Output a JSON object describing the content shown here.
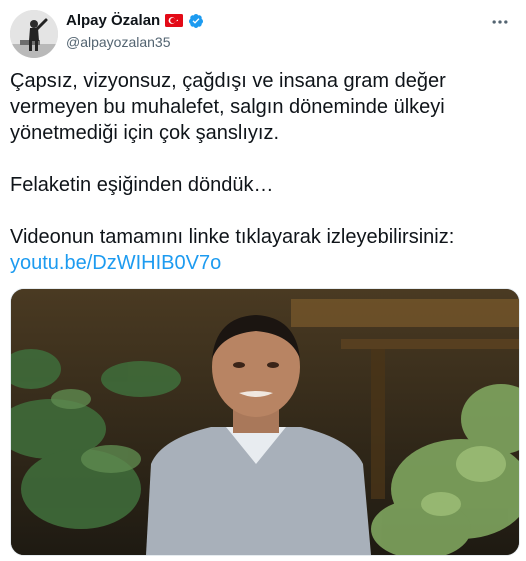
{
  "author": {
    "name": "Alpay Özalan",
    "handle": "@alpayozalan35",
    "flag_icon": "turkey-flag-icon",
    "verified_icon": "verified-badge-icon",
    "verified_color": "#1d9bf0"
  },
  "menu": {
    "icon": "more-options-icon"
  },
  "tweet": {
    "line1": "Çapsız, vizyonsuz, çağdışı ve insana gram değer vermeyen bu muhalefet, salgın döneminde ülkeyi yönetmediği için çok şanslıyız.",
    "line2": "Felaketin eşiğinden döndük…",
    "line3": "Videonun tamamını linke tıklayarak izleyebilirsiniz:",
    "link": "youtu.be/DzWIHIB0V7o"
  },
  "colors": {
    "text": "#0f1419",
    "secondary": "#536471",
    "link": "#1d9bf0"
  }
}
